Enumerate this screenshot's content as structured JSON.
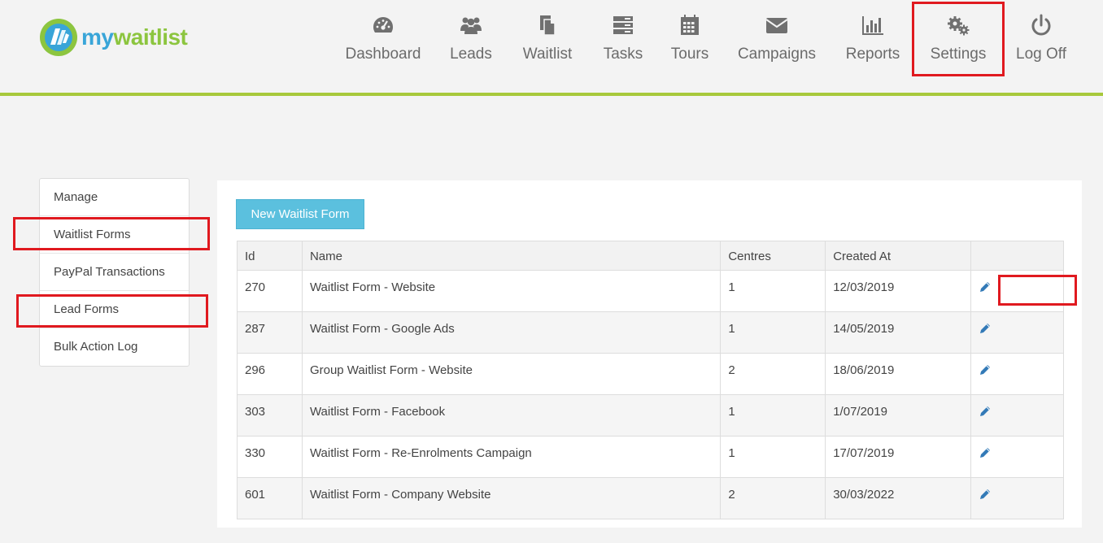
{
  "brand": {
    "prefix": "my",
    "suffix": "waitlist"
  },
  "nav": {
    "items": [
      {
        "label": "Dashboard",
        "icon": "dashboard-icon"
      },
      {
        "label": "Leads",
        "icon": "users-icon"
      },
      {
        "label": "Waitlist",
        "icon": "documents-icon"
      },
      {
        "label": "Tasks",
        "icon": "server-icon"
      },
      {
        "label": "Tours",
        "icon": "calendar-icon"
      },
      {
        "label": "Campaigns",
        "icon": "envelope-icon"
      },
      {
        "label": "Reports",
        "icon": "bar-chart-icon"
      },
      {
        "label": "Settings",
        "icon": "gears-icon"
      },
      {
        "label": "Log Off",
        "icon": "power-icon"
      }
    ]
  },
  "sidebar": {
    "items": [
      {
        "label": "Manage"
      },
      {
        "label": "Waitlist Forms"
      },
      {
        "label": "PayPal Transactions"
      },
      {
        "label": "Lead Forms"
      },
      {
        "label": "Bulk Action Log"
      }
    ]
  },
  "main": {
    "new_button_label": "New Waitlist Form",
    "table": {
      "headers": [
        "Id",
        "Name",
        "Centres",
        "Created At",
        ""
      ],
      "rows": [
        {
          "id": "270",
          "name": "Waitlist Form - Website",
          "centres": "1",
          "created_at": "12/03/2019"
        },
        {
          "id": "287",
          "name": "Waitlist Form - Google Ads",
          "centres": "1",
          "created_at": "14/05/2019"
        },
        {
          "id": "296",
          "name": "Group Waitlist Form - Website",
          "centres": "2",
          "created_at": "18/06/2019"
        },
        {
          "id": "303",
          "name": "Waitlist Form - Facebook",
          "centres": "1",
          "created_at": "1/07/2019"
        },
        {
          "id": "330",
          "name": "Waitlist Form - Re-Enrolments Campaign",
          "centres": "1",
          "created_at": "17/07/2019"
        },
        {
          "id": "601",
          "name": "Waitlist Form - Company Website",
          "centres": "2",
          "created_at": "30/03/2022"
        }
      ]
    }
  },
  "colors": {
    "accent_green": "#a7c83b",
    "button_blue": "#5bc0de",
    "highlight_red": "#e0191f",
    "edit_icon_blue": "#337ab7"
  }
}
